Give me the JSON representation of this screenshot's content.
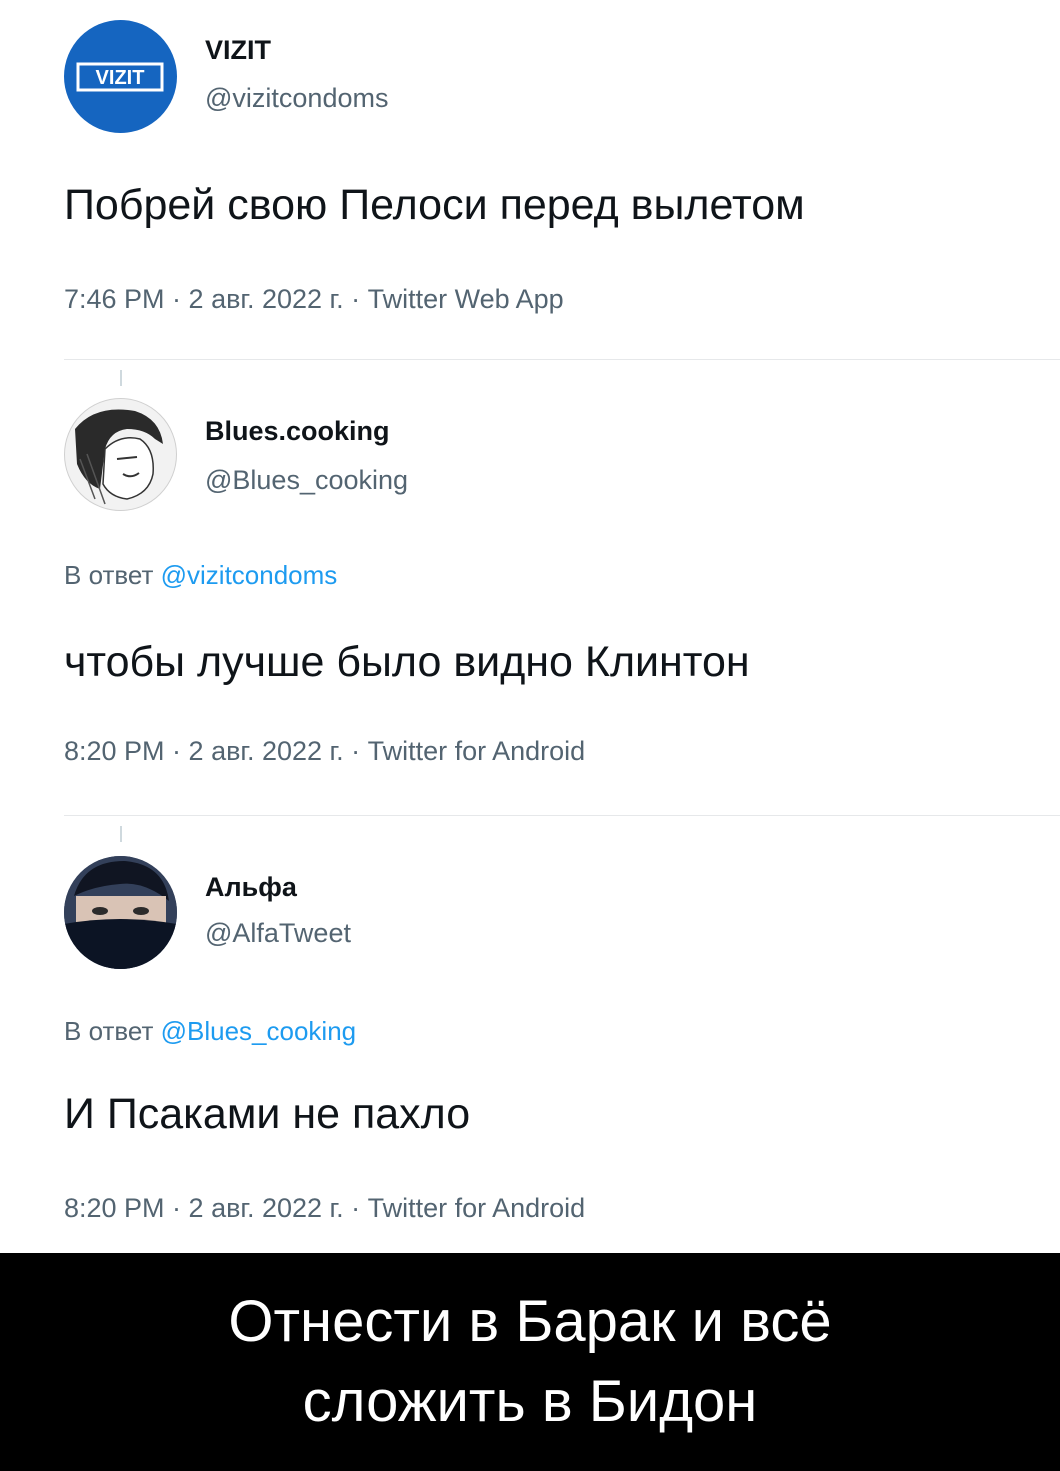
{
  "tweets": [
    {
      "name": "VIZIT",
      "handle": "@vizitcondoms",
      "avatar_label": "VIZIT",
      "reply_prefix": "",
      "reply_to": "",
      "text": "Побрей свою Пелоси перед вылетом",
      "meta": "7:46 PM · 2 авг. 2022 г. · Twitter Web App"
    },
    {
      "name": "Blues.cooking",
      "handle": "@Blues_cooking",
      "reply_prefix": "В ответ",
      "reply_to": "@vizitcondoms",
      "text": "чтобы лучше было видно Клинтон",
      "meta": "8:20 PM · 2 авг. 2022 г. · Twitter for Android"
    },
    {
      "name": "Альфа",
      "handle": "@AlfaTweet",
      "reply_prefix": "В ответ",
      "reply_to": "@Blues_cooking",
      "text": "И Псаками не пахло",
      "meta": "8:20 PM · 2 авг. 2022 г. · Twitter for Android"
    }
  ],
  "caption": {
    "line1": "Отнести в Барак и всё",
    "line2": "сложить в Бидон"
  },
  "colors": {
    "vizit_brand": "#1565c0",
    "mention": "#1d9bf0",
    "muted": "#536471",
    "caption_bg": "#000000"
  }
}
